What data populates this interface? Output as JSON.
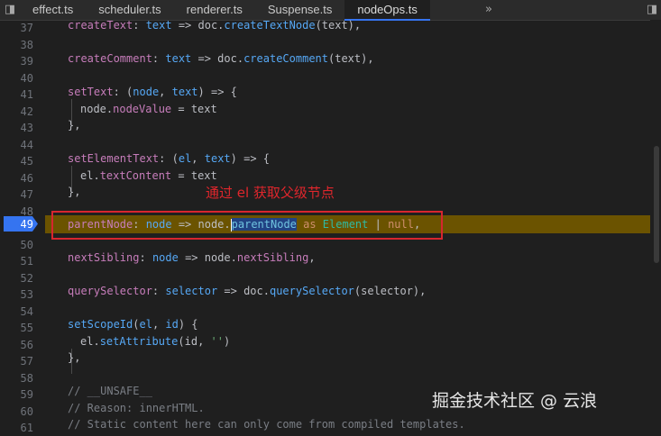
{
  "tabs": [
    "effect.ts",
    "scheduler.ts",
    "renderer.ts",
    "Suspense.ts",
    "nodeOps.ts"
  ],
  "tabs_overflow_glyph": "»",
  "tabs_collapse_glyph": "◨",
  "current_line": "49",
  "line_numbers": [
    "37",
    "38",
    "39",
    "40",
    "41",
    "42",
    "43",
    "44",
    "45",
    "46",
    "47",
    "48",
    "49",
    "50",
    "51",
    "52",
    "53",
    "54",
    "55",
    "56",
    "57",
    "58",
    "59",
    "60",
    "61"
  ],
  "code": {
    "l37": {
      "field": "createText",
      "param": "text",
      "arrow": " => doc.",
      "method": "createTextNode",
      "rest": "(text),"
    },
    "l39": {
      "field": "createComment",
      "colon": ": ",
      "param": "text",
      "arrow": " => doc.",
      "method": "createComment",
      "rest": "(text),"
    },
    "l41": {
      "field": "setText",
      "open": ": (",
      "p1": "node",
      "comma": ", ",
      "p2": "text",
      "rest": ") => {"
    },
    "l42": {
      "pre": "node.",
      "prop": "nodeValue",
      "rest": " = text"
    },
    "l43": {
      "text": "},"
    },
    "l45": {
      "field": "setElementText",
      "open": ": (",
      "p1": "el",
      "comma": ", ",
      "p2": "text",
      "rest": ") => {"
    },
    "l46": {
      "pre": "el.",
      "prop": "textContent",
      "rest": " = text"
    },
    "l47": {
      "text": "},"
    },
    "l49": {
      "field": "parentNode",
      "colon": ": ",
      "param": "node",
      "arrow": " => node.",
      "selected": "parentNode",
      "as_kw": " as ",
      "type": "Element",
      "pipe": " | ",
      "null_kw": "null",
      "rest": ","
    },
    "l51": {
      "field": "nextSibling",
      "colon": ": ",
      "param": "node",
      "arrow": " => node.",
      "prop": "nextSibling",
      "rest": ","
    },
    "l53": {
      "field": "querySelector",
      "colon": ": ",
      "param": "selector",
      "arrow": " => doc.",
      "method": "querySelector",
      "rest": "(selector),"
    },
    "l55": {
      "method": "setScopeId",
      "open": "(",
      "p1": "el",
      "comma": ", ",
      "p2": "id",
      "rest": ") {"
    },
    "l56": {
      "pre": "el.",
      "method": "setAttribute",
      "open": "(id, ",
      "str": "''",
      "rest": ")"
    },
    "l57": {
      "text": "},"
    },
    "l59": {
      "text": "// __UNSAFE__"
    },
    "l60": {
      "text": "// Reason: innerHTML."
    },
    "l61": {
      "text": "// Static content here can only come from compiled templates."
    }
  },
  "annotation": "通过 el 获取父级节点",
  "watermark": "掘金技术社区 @ 云浪"
}
